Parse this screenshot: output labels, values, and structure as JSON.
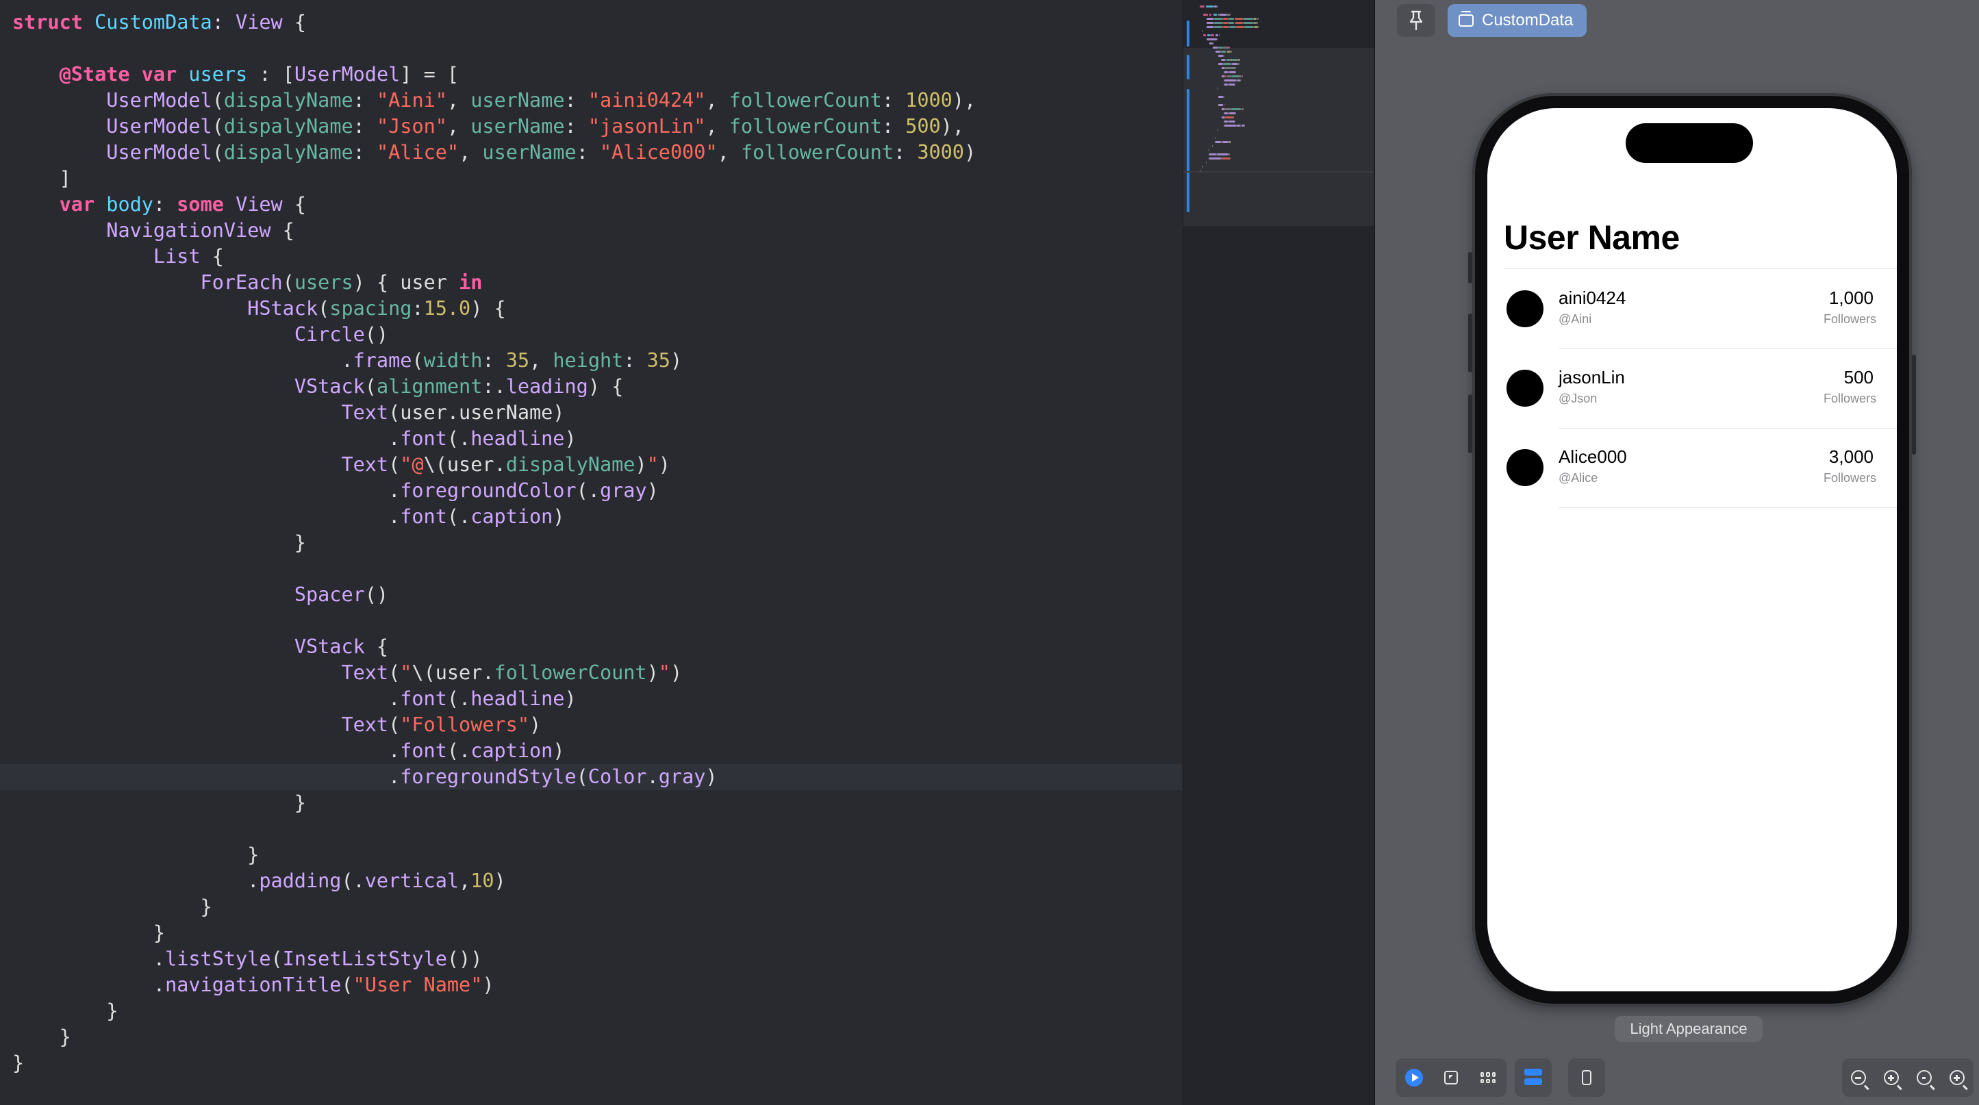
{
  "editor": {
    "lines": [
      [
        [
          "kw",
          "struct"
        ],
        [
          "pl",
          " "
        ],
        [
          "ty",
          "CustomData"
        ],
        [
          "pl",
          ": "
        ],
        [
          "ty2",
          "View"
        ],
        [
          "pl",
          " {"
        ]
      ],
      [],
      [
        [
          "pl",
          "    "
        ],
        [
          "kw",
          "@State"
        ],
        [
          "pl",
          " "
        ],
        [
          "kw",
          "var"
        ],
        [
          "pl",
          " "
        ],
        [
          "ty",
          "users"
        ],
        [
          "pl",
          " : ["
        ],
        [
          "ty2",
          "UserModel"
        ],
        [
          "pl",
          "] = ["
        ]
      ],
      [
        [
          "pl",
          "        "
        ],
        [
          "ty2",
          "UserModel"
        ],
        [
          "pl",
          "("
        ],
        [
          "pr",
          "dispalyName"
        ],
        [
          "pl",
          ": "
        ],
        [
          "st",
          "\"Aini\""
        ],
        [
          "pl",
          ", "
        ],
        [
          "pr",
          "userName"
        ],
        [
          "pl",
          ": "
        ],
        [
          "st",
          "\"aini0424\""
        ],
        [
          "pl",
          ", "
        ],
        [
          "pr",
          "followerCount"
        ],
        [
          "pl",
          ": "
        ],
        [
          "nm",
          "1000"
        ],
        [
          "pl",
          "),"
        ]
      ],
      [
        [
          "pl",
          "        "
        ],
        [
          "ty2",
          "UserModel"
        ],
        [
          "pl",
          "("
        ],
        [
          "pr",
          "dispalyName"
        ],
        [
          "pl",
          ": "
        ],
        [
          "st",
          "\"Json\""
        ],
        [
          "pl",
          ", "
        ],
        [
          "pr",
          "userName"
        ],
        [
          "pl",
          ": "
        ],
        [
          "st",
          "\"jasonLin\""
        ],
        [
          "pl",
          ", "
        ],
        [
          "pr",
          "followerCount"
        ],
        [
          "pl",
          ": "
        ],
        [
          "nm",
          "500"
        ],
        [
          "pl",
          "),"
        ]
      ],
      [
        [
          "pl",
          "        "
        ],
        [
          "ty2",
          "UserModel"
        ],
        [
          "pl",
          "("
        ],
        [
          "pr",
          "dispalyName"
        ],
        [
          "pl",
          ": "
        ],
        [
          "st",
          "\"Alice\""
        ],
        [
          "pl",
          ", "
        ],
        [
          "pr",
          "userName"
        ],
        [
          "pl",
          ": "
        ],
        [
          "st",
          "\"Alice000\""
        ],
        [
          "pl",
          ", "
        ],
        [
          "pr",
          "followerCount"
        ],
        [
          "pl",
          ": "
        ],
        [
          "nm",
          "3000"
        ],
        [
          "pl",
          ")"
        ]
      ],
      [
        [
          "pl",
          "    ]"
        ]
      ],
      [
        [
          "pl",
          "    "
        ],
        [
          "kw",
          "var"
        ],
        [
          "pl",
          " "
        ],
        [
          "ty",
          "body"
        ],
        [
          "pl",
          ": "
        ],
        [
          "kw",
          "some"
        ],
        [
          "pl",
          " "
        ],
        [
          "ty2",
          "View"
        ],
        [
          "pl",
          " {"
        ]
      ],
      [
        [
          "pl",
          "        "
        ],
        [
          "ty2",
          "NavigationView"
        ],
        [
          "pl",
          " {"
        ]
      ],
      [
        [
          "pl",
          "            "
        ],
        [
          "ty2",
          "List"
        ],
        [
          "pl",
          " {"
        ]
      ],
      [
        [
          "pl",
          "                "
        ],
        [
          "ty2",
          "ForEach"
        ],
        [
          "pl",
          "("
        ],
        [
          "pr",
          "users"
        ],
        [
          "pl",
          ") { user "
        ],
        [
          "kw",
          "in"
        ]
      ],
      [
        [
          "pl",
          "                    "
        ],
        [
          "ty2",
          "HStack"
        ],
        [
          "pl",
          "("
        ],
        [
          "pr",
          "spacing"
        ],
        [
          "pl",
          ":"
        ],
        [
          "nm",
          "15.0"
        ],
        [
          "pl",
          ") {"
        ]
      ],
      [
        [
          "pl",
          "                        "
        ],
        [
          "ty2",
          "Circle"
        ],
        [
          "pl",
          "()"
        ]
      ],
      [
        [
          "pl",
          "                            ."
        ],
        [
          "fn",
          "frame"
        ],
        [
          "pl",
          "("
        ],
        [
          "pr",
          "width"
        ],
        [
          "pl",
          ": "
        ],
        [
          "nm",
          "35"
        ],
        [
          "pl",
          ", "
        ],
        [
          "pr",
          "height"
        ],
        [
          "pl",
          ": "
        ],
        [
          "nm",
          "35"
        ],
        [
          "pl",
          ")"
        ]
      ],
      [
        [
          "pl",
          "                        "
        ],
        [
          "ty2",
          "VStack"
        ],
        [
          "pl",
          "("
        ],
        [
          "pr",
          "alignment"
        ],
        [
          "pl",
          ":."
        ],
        [
          "at",
          "leading"
        ],
        [
          "pl",
          ") {"
        ]
      ],
      [
        [
          "pl",
          "                            "
        ],
        [
          "ty2",
          "Text"
        ],
        [
          "pl",
          "(user.userName)"
        ]
      ],
      [
        [
          "pl",
          "                                ."
        ],
        [
          "fn",
          "font"
        ],
        [
          "pl",
          "(."
        ],
        [
          "at",
          "headline"
        ],
        [
          "pl",
          ")"
        ]
      ],
      [
        [
          "pl",
          "                            "
        ],
        [
          "ty2",
          "Text"
        ],
        [
          "pl",
          "("
        ],
        [
          "st",
          "\"@"
        ],
        [
          "pl",
          "\\(user."
        ],
        [
          "pr",
          "dispalyName"
        ],
        [
          "pl",
          ")"
        ],
        [
          "st",
          "\""
        ],
        [
          "pl",
          ")"
        ]
      ],
      [
        [
          "pl",
          "                                ."
        ],
        [
          "fn",
          "foregroundColor"
        ],
        [
          "pl",
          "(."
        ],
        [
          "at",
          "gray"
        ],
        [
          "pl",
          ")"
        ]
      ],
      [
        [
          "pl",
          "                                ."
        ],
        [
          "fn",
          "font"
        ],
        [
          "pl",
          "(."
        ],
        [
          "at",
          "caption"
        ],
        [
          "pl",
          ")"
        ]
      ],
      [
        [
          "pl",
          "                        }"
        ]
      ],
      [],
      [
        [
          "pl",
          "                        "
        ],
        [
          "ty2",
          "Spacer"
        ],
        [
          "pl",
          "()"
        ]
      ],
      [],
      [
        [
          "pl",
          "                        "
        ],
        [
          "ty2",
          "VStack"
        ],
        [
          "pl",
          " {"
        ]
      ],
      [
        [
          "pl",
          "                            "
        ],
        [
          "ty2",
          "Text"
        ],
        [
          "pl",
          "("
        ],
        [
          "st",
          "\""
        ],
        [
          "pl",
          "\\(user."
        ],
        [
          "pr",
          "followerCount"
        ],
        [
          "pl",
          ")"
        ],
        [
          "st",
          "\""
        ],
        [
          "pl",
          ")"
        ]
      ],
      [
        [
          "pl",
          "                                ."
        ],
        [
          "fn",
          "font"
        ],
        [
          "pl",
          "(."
        ],
        [
          "at",
          "headline"
        ],
        [
          "pl",
          ")"
        ]
      ],
      [
        [
          "pl",
          "                            "
        ],
        [
          "ty2",
          "Text"
        ],
        [
          "pl",
          "("
        ],
        [
          "st",
          "\"Followers\""
        ],
        [
          "pl",
          ")"
        ]
      ],
      [
        [
          "pl",
          "                                ."
        ],
        [
          "fn",
          "font"
        ],
        [
          "pl",
          "(."
        ],
        [
          "at",
          "caption"
        ],
        [
          "pl",
          ")"
        ]
      ],
      [
        [
          "pl",
          "                                ."
        ],
        [
          "fn",
          "foregroundStyle"
        ],
        [
          "pl",
          "("
        ],
        [
          "ty2",
          "Color"
        ],
        [
          "pl",
          "."
        ],
        [
          "at",
          "gray"
        ],
        [
          "pl",
          ")"
        ]
      ],
      [
        [
          "pl",
          "                        }"
        ]
      ],
      [],
      [
        [
          "pl",
          "                    }"
        ]
      ],
      [
        [
          "pl",
          "                    ."
        ],
        [
          "fn",
          "padding"
        ],
        [
          "pl",
          "(."
        ],
        [
          "at",
          "vertical"
        ],
        [
          "pl",
          ","
        ],
        [
          "nm",
          "10"
        ],
        [
          "pl",
          ")"
        ]
      ],
      [
        [
          "pl",
          "                }"
        ]
      ],
      [
        [
          "pl",
          "            }"
        ]
      ],
      [
        [
          "pl",
          "            ."
        ],
        [
          "fn",
          "listStyle"
        ],
        [
          "pl",
          "("
        ],
        [
          "ty2",
          "InsetListStyle"
        ],
        [
          "pl",
          "())"
        ]
      ],
      [
        [
          "pl",
          "            ."
        ],
        [
          "fn",
          "navigationTitle"
        ],
        [
          "pl",
          "("
        ],
        [
          "st",
          "\"User Name\""
        ],
        [
          "pl",
          ")"
        ]
      ],
      [
        [
          "pl",
          "        }"
        ]
      ],
      [
        [
          "pl",
          "    }"
        ]
      ],
      [
        [
          "pl",
          "}"
        ]
      ]
    ],
    "current_line": 29
  },
  "canvas": {
    "pin_icon": "pin-icon",
    "preview_label": "CustomData",
    "appearance_label": "Light Appearance",
    "app": {
      "nav_title": "User Name",
      "users": [
        {
          "user_name": "aini0424",
          "display_name": "@Aini",
          "followers": "1,000",
          "followers_label": "Followers"
        },
        {
          "user_name": "jasonLin",
          "display_name": "@Json",
          "followers": "500",
          "followers_label": "Followers"
        },
        {
          "user_name": "Alice000",
          "display_name": "@Alice",
          "followers": "3,000",
          "followers_label": "Followers"
        }
      ]
    },
    "toolbar": {
      "left": [
        "live-preview-icon",
        "selectable-icon",
        "grid-icon"
      ],
      "variants": "variants-icon",
      "device": "device-settings-icon",
      "zoom": [
        "zoom-out-icon",
        "zoom-in-icon",
        "zoom-100-icon",
        "zoom-fit-icon"
      ]
    }
  }
}
